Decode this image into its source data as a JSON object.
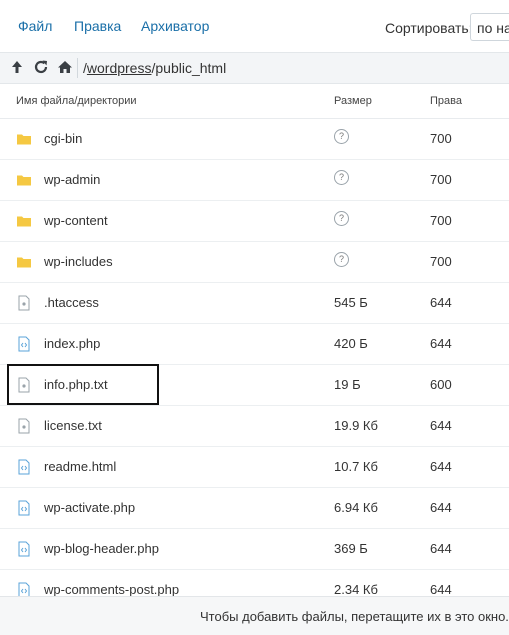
{
  "menu": {
    "file": "Файл",
    "edit": "Правка",
    "archiver": "Архиватор",
    "sort_label": "Сортировать:",
    "sort_value": "по на"
  },
  "toolbar": {
    "path_sep1": "/",
    "path_dir1": "wordpress",
    "path_sep2": "/public_html"
  },
  "table": {
    "col_name": "Имя файла/директории",
    "col_size": "Размер",
    "col_perm": "Права"
  },
  "files": [
    {
      "name": "cgi-bin",
      "type": "folder",
      "size": "?",
      "perm": "700"
    },
    {
      "name": "wp-admin",
      "type": "folder",
      "size": "?",
      "perm": "700"
    },
    {
      "name": "wp-content",
      "type": "folder",
      "size": "?",
      "perm": "700"
    },
    {
      "name": "wp-includes",
      "type": "folder",
      "size": "?",
      "perm": "700"
    },
    {
      "name": ".htaccess",
      "type": "file",
      "size": "545 Б",
      "perm": "644"
    },
    {
      "name": "index.php",
      "type": "code",
      "size": "420 Б",
      "perm": "644"
    },
    {
      "name": "info.php.txt",
      "type": "file",
      "size": "19 Б",
      "perm": "600"
    },
    {
      "name": "license.txt",
      "type": "file",
      "size": "19.9 Кб",
      "perm": "644"
    },
    {
      "name": "readme.html",
      "type": "code",
      "size": "10.7 Кб",
      "perm": "644"
    },
    {
      "name": "wp-activate.php",
      "type": "code",
      "size": "6.94 Кб",
      "perm": "644"
    },
    {
      "name": "wp-blog-header.php",
      "type": "code",
      "size": "369 Б",
      "perm": "644"
    },
    {
      "name": "wp-comments-post.php",
      "type": "code",
      "size": "2.34 Кб",
      "perm": "644"
    }
  ],
  "footer": {
    "hint": "Чтобы добавить файлы, перетащите их в это окно."
  },
  "colors": {
    "link": "#1a6fa8",
    "folder": "#f5c842",
    "code_icon": "#5aa3d8",
    "file_icon": "#9aa3aa"
  }
}
